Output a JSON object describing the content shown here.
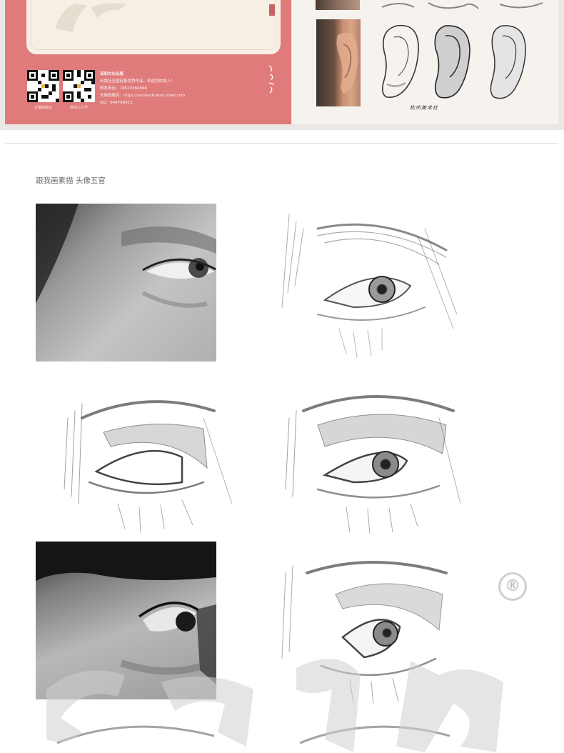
{
  "cover_left": {
    "qr_labels": [
      "天猫旗舰店",
      "微信公众号"
    ],
    "publisher_name": "亚和文化出版",
    "publisher_lines": [
      "出版社全国征集优秀作品，欢迎您的加入！",
      "联系电话：18620366886",
      "天猫旗舰店：https://yanhechuban.tmall.com",
      "QQ：644799913"
    ],
    "spine_seal": "亚和",
    "signature": "杭州美术社"
  },
  "cover_right": {
    "signature": "杭州美术社"
  },
  "page": {
    "caption": "跟我画素描  头像五官",
    "registered_mark": "®",
    "watermark_text": "亚和出版"
  },
  "colors": {
    "cover_pink": "#e07b7b",
    "cream": "#f7efe4"
  }
}
